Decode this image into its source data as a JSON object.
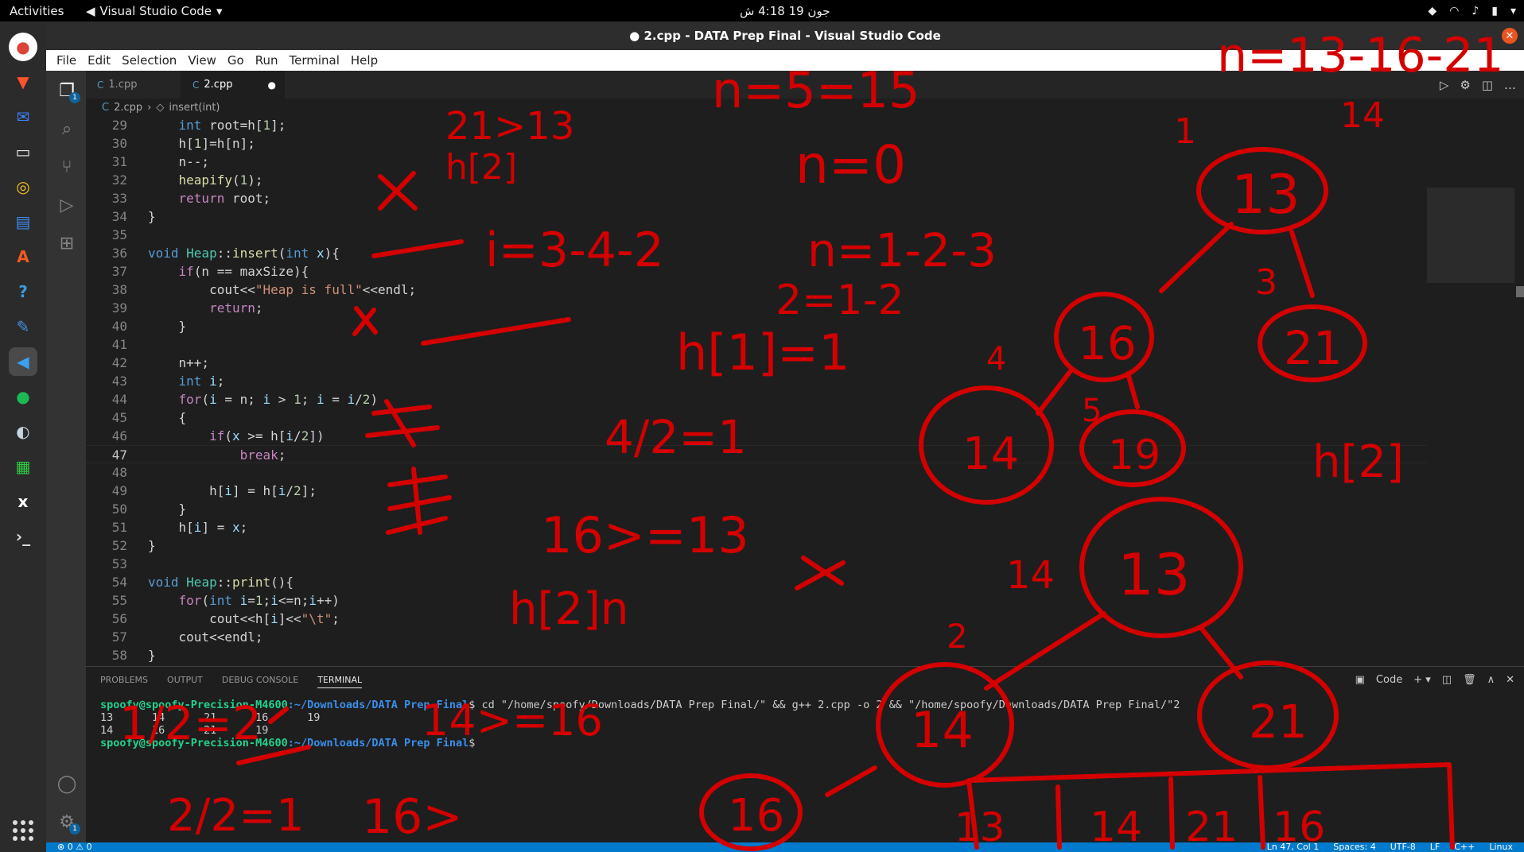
{
  "system": {
    "activities": "Activities",
    "app_name": "Visual Studio Code",
    "clock": "جون 19  4:18 ش"
  },
  "window": {
    "title": "● 2.cpp - DATA Prep Final - Visual Studio Code"
  },
  "menu": [
    "File",
    "Edit",
    "Selection",
    "View",
    "Go",
    "Run",
    "Terminal",
    "Help"
  ],
  "tabs": [
    {
      "label": "1.cpp"
    },
    {
      "label": "2.cpp",
      "dirty": "●"
    }
  ],
  "breadcrumb": {
    "file": "2.cpp",
    "symbol": "insert(int)"
  },
  "code": {
    "lines": [
      {
        "num": "29",
        "text": "    int root=h[1];"
      },
      {
        "num": "30",
        "text": "    h[1]=h[n];"
      },
      {
        "num": "31",
        "text": "    n--;"
      },
      {
        "num": "32",
        "text": "    heapify(1);"
      },
      {
        "num": "33",
        "text": "    return root;"
      },
      {
        "num": "34",
        "text": "}"
      },
      {
        "num": "35",
        "text": ""
      },
      {
        "num": "36",
        "text": "void Heap::insert(int x){"
      },
      {
        "num": "37",
        "text": "    if(n == maxSize){"
      },
      {
        "num": "38",
        "text": "        cout<<\"Heap is full\"<<endl;"
      },
      {
        "num": "39",
        "text": "        return;"
      },
      {
        "num": "40",
        "text": "    }"
      },
      {
        "num": "41",
        "text": ""
      },
      {
        "num": "42",
        "text": "    n++;"
      },
      {
        "num": "43",
        "text": "    int i;"
      },
      {
        "num": "44",
        "text": "    for(i = n; i > 1; i = i/2)"
      },
      {
        "num": "45",
        "text": "    {"
      },
      {
        "num": "46",
        "text": "        if(x >= h[i/2])"
      },
      {
        "num": "47",
        "text": "            break;"
      },
      {
        "num": "48",
        "text": ""
      },
      {
        "num": "49",
        "text": "        h[i] = h[i/2];"
      },
      {
        "num": "50",
        "text": "    }"
      },
      {
        "num": "51",
        "text": "    h[i] = x;"
      },
      {
        "num": "52",
        "text": "}"
      },
      {
        "num": "53",
        "text": ""
      },
      {
        "num": "54",
        "text": "void Heap::print(){"
      },
      {
        "num": "55",
        "text": "    for(int i=1;i<=n;i++)"
      },
      {
        "num": "56",
        "text": "        cout<<h[i]<<\"\\t\";"
      },
      {
        "num": "57",
        "text": "    cout<<endl;"
      },
      {
        "num": "58",
        "text": "}"
      }
    ]
  },
  "panel": {
    "tabs": [
      "PROBLEMS",
      "OUTPUT",
      "DEBUG CONSOLE",
      "TERMINAL"
    ],
    "shell_label": "Code",
    "prompt_user": "spoofy@spoofy-Precision-M4600",
    "prompt_path": ":~/Downloads/DATA Prep Final",
    "command": "$ cd \"/home/spoofy/Downloads/DATA Prep Final/\" && g++ 2.cpp -o 2 && \"/home/spoofy/Downloads/DATA Prep Final/\"2",
    "output_lines": [
      "13      14      21      16      19",
      "14      16      21      19"
    ],
    "prompt_end": "$"
  },
  "statusbar": {
    "problems": "⊗ 0  ⚠ 0",
    "items": [
      "Ln 47, Col 1",
      "Spaces: 4",
      "UTF-8",
      "LF",
      "C++",
      "Linux"
    ]
  },
  "annotations": {
    "texts": [
      "n=13-16-21",
      "14",
      "n=5=15",
      "21>13",
      "h[2]",
      "n=0",
      "i=3-4-2",
      "n=1-2-3",
      "2=1-2",
      "h[1]=1",
      "4",
      "13",
      "3",
      "21",
      "16",
      "14",
      "19",
      "5",
      "h[2]",
      "4/2=1",
      "16>=13",
      "h[2]n",
      "14",
      "13",
      "2",
      "14",
      "21",
      "16",
      "1/2=2",
      "14>=16",
      "2/2=1",
      "16>",
      "13",
      "14",
      "21",
      "16",
      "1"
    ]
  },
  "colors": {
    "accent": "#007acc",
    "ink": "#d40000",
    "editor_bg": "#1e1e1e"
  }
}
